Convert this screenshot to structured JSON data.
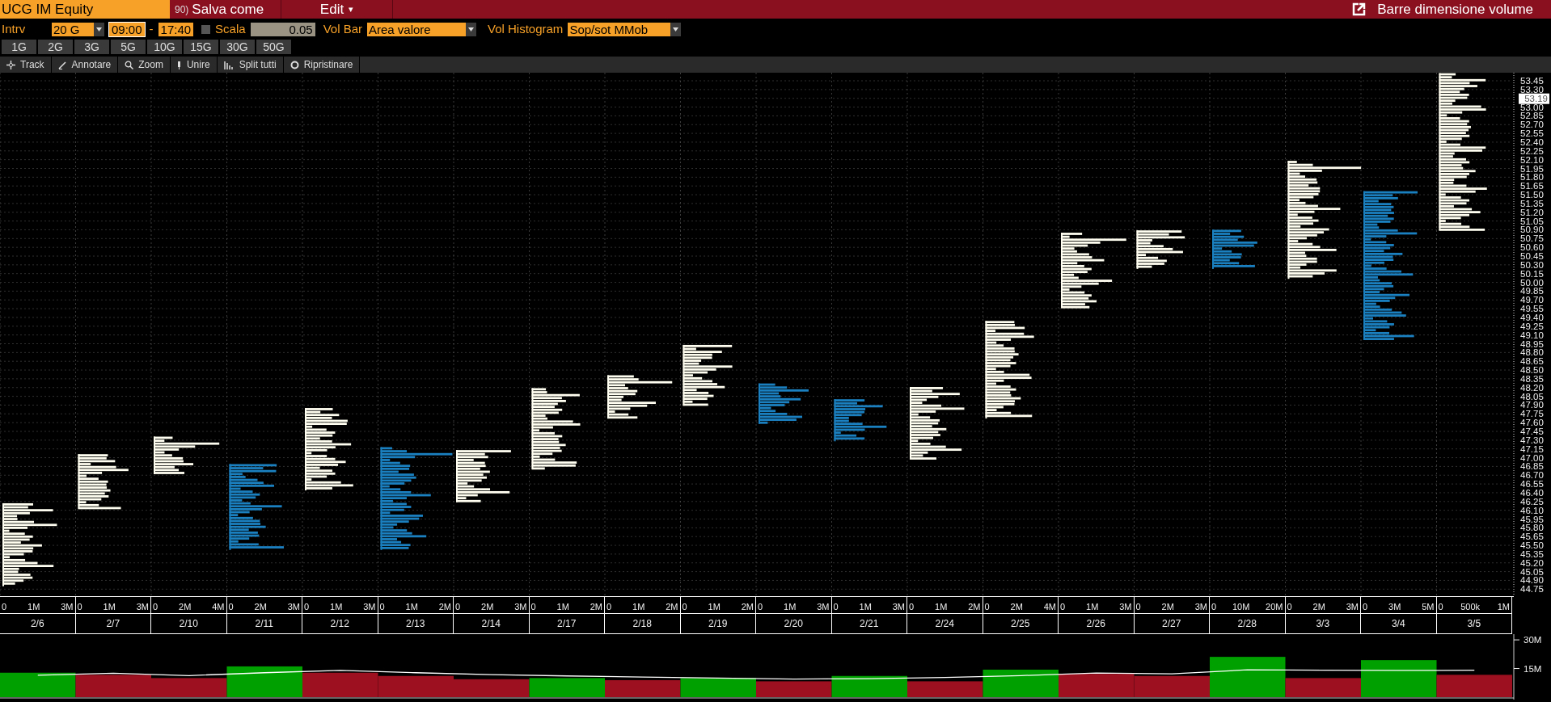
{
  "header": {
    "ticker": "UCG IM Equity",
    "save_tag": "90)",
    "save_label": "Salva come",
    "edit_label": "Edit",
    "edit_caret": "▾",
    "right_label": "Barre dimensione volume"
  },
  "controls": {
    "interval_label": "Intrv",
    "interval_value": "20 G",
    "time_from": "09:00",
    "time_sep": "-",
    "time_to": "17:40",
    "scale_checked": false,
    "scale_label": "Scala",
    "scale_value": "0.05",
    "volbar_label": "Vol Bar",
    "volbar_value": "Area valore",
    "volhist_label": "Vol Histogram",
    "volhist_value": "Sop/sot MMob"
  },
  "periods": [
    {
      "label": "1G",
      "selected": false
    },
    {
      "label": "2G",
      "selected": false
    },
    {
      "label": "3G",
      "selected": false
    },
    {
      "label": "5G",
      "selected": false
    },
    {
      "label": "10G",
      "selected": false
    },
    {
      "label": "15G",
      "selected": false
    },
    {
      "label": "30G",
      "selected": false
    },
    {
      "label": "50G",
      "selected": false
    }
  ],
  "tools": [
    {
      "kind": "track",
      "label": "Track"
    },
    {
      "kind": "annotate",
      "label": "Annotare"
    },
    {
      "kind": "zoom",
      "label": "Zoom"
    },
    {
      "kind": "merge",
      "label": "Unire"
    },
    {
      "kind": "split",
      "label": "Split tutti"
    },
    {
      "kind": "reset",
      "label": "Ripristinare"
    }
  ],
  "price_axis": [
    {
      "kind": "tick",
      "label": "53.45"
    },
    {
      "kind": "tick",
      "label": "53.30"
    },
    {
      "kind": "last",
      "label": "53.19"
    },
    {
      "kind": "tick",
      "label": "53.00"
    },
    {
      "kind": "tick",
      "label": "52.85"
    },
    {
      "kind": "tick",
      "label": "52.70"
    },
    {
      "kind": "tick",
      "label": "52.55"
    },
    {
      "kind": "tick",
      "label": "52.40"
    },
    {
      "kind": "tick",
      "label": "52.25"
    },
    {
      "kind": "tick",
      "label": "52.10"
    },
    {
      "kind": "tick",
      "label": "51.95"
    },
    {
      "kind": "tick",
      "label": "51.80"
    },
    {
      "kind": "tick",
      "label": "51.65"
    },
    {
      "kind": "tick",
      "label": "51.50"
    },
    {
      "kind": "tick",
      "label": "51.35"
    },
    {
      "kind": "tick",
      "label": "51.20"
    },
    {
      "kind": "tick",
      "label": "51.05"
    },
    {
      "kind": "tick",
      "label": "50.90"
    },
    {
      "kind": "tick",
      "label": "50.75"
    },
    {
      "kind": "tick",
      "label": "50.60"
    },
    {
      "kind": "tick",
      "label": "50.45"
    },
    {
      "kind": "tick",
      "label": "50.30"
    },
    {
      "kind": "tick",
      "label": "50.15"
    },
    {
      "kind": "tick",
      "label": "50.00"
    },
    {
      "kind": "tick",
      "label": "49.85"
    },
    {
      "kind": "tick",
      "label": "49.70"
    },
    {
      "kind": "tick",
      "label": "49.55"
    },
    {
      "kind": "tick",
      "label": "49.40"
    },
    {
      "kind": "tick",
      "label": "49.25"
    },
    {
      "kind": "tick",
      "label": "49.10"
    },
    {
      "kind": "tick",
      "label": "48.95"
    },
    {
      "kind": "tick",
      "label": "48.80"
    },
    {
      "kind": "tick",
      "label": "48.65"
    },
    {
      "kind": "tick",
      "label": "48.50"
    },
    {
      "kind": "tick",
      "label": "48.35"
    },
    {
      "kind": "tick",
      "label": "48.20"
    },
    {
      "kind": "tick",
      "label": "48.05"
    },
    {
      "kind": "tick",
      "label": "47.90"
    },
    {
      "kind": "tick",
      "label": "47.75"
    },
    {
      "kind": "tick",
      "label": "47.60"
    },
    {
      "kind": "tick",
      "label": "47.45"
    },
    {
      "kind": "tick",
      "label": "47.30"
    },
    {
      "kind": "tick",
      "label": "47.15"
    },
    {
      "kind": "tick",
      "label": "47.00"
    },
    {
      "kind": "tick",
      "label": "46.85"
    },
    {
      "kind": "tick",
      "label": "46.70"
    },
    {
      "kind": "tick",
      "label": "46.55"
    },
    {
      "kind": "tick",
      "label": "46.40"
    },
    {
      "kind": "tick",
      "label": "46.25"
    },
    {
      "kind": "tick",
      "label": "46.10"
    },
    {
      "kind": "tick",
      "label": "45.95"
    },
    {
      "kind": "tick",
      "label": "45.80"
    },
    {
      "kind": "tick",
      "label": "45.65"
    },
    {
      "kind": "tick",
      "label": "45.50"
    },
    {
      "kind": "tick",
      "label": "45.35"
    },
    {
      "kind": "tick",
      "label": "45.20"
    },
    {
      "kind": "tick",
      "label": "45.05"
    },
    {
      "kind": "tick",
      "label": "44.90"
    },
    {
      "kind": "tick",
      "label": "44.75"
    }
  ],
  "days": [
    {
      "color": "#fffef0",
      "scale": [
        "0",
        "1M",
        "3M"
      ]
    },
    {
      "color": "#fffef0",
      "scale": [
        "0",
        "1M",
        "3M"
      ]
    },
    {
      "color": "#fffef0",
      "scale": [
        "0",
        "2M",
        "4M"
      ]
    },
    {
      "color": "#1b80c0",
      "scale": [
        "0",
        "2M",
        "3M"
      ]
    },
    {
      "color": "#fffef0",
      "scale": [
        "0",
        "1M",
        "3M"
      ]
    },
    {
      "color": "#1b80c0",
      "scale": [
        "0",
        "1M",
        "2M"
      ]
    },
    {
      "color": "#fffef0",
      "scale": [
        "0",
        "2M",
        "3M"
      ]
    },
    {
      "color": "#fffef0",
      "scale": [
        "0",
        "1M",
        "2M"
      ]
    },
    {
      "color": "#fffef0",
      "scale": [
        "0",
        "1M",
        "2M"
      ]
    },
    {
      "color": "#fffef0",
      "scale": [
        "0",
        "1M",
        "2M"
      ]
    },
    {
      "color": "#1b80c0",
      "scale": [
        "0",
        "1M",
        "3M"
      ]
    },
    {
      "color": "#1b80c0",
      "scale": [
        "0",
        "1M",
        "3M"
      ]
    },
    {
      "color": "#fffef0",
      "scale": [
        "0",
        "1M",
        "2M"
      ]
    },
    {
      "color": "#fffef0",
      "scale": [
        "0",
        "2M",
        "4M"
      ]
    },
    {
      "color": "#fffef0",
      "scale": [
        "0",
        "1M",
        "3M"
      ]
    },
    {
      "color": "#fffef0",
      "scale": [
        "0",
        "2M",
        "3M"
      ]
    },
    {
      "color": "#1b80c0",
      "scale": [
        "0",
        "10M",
        "20M"
      ]
    },
    {
      "color": "#fffef0",
      "scale": [
        "0",
        "2M",
        "3M"
      ]
    },
    {
      "color": "#1b80c0",
      "scale": [
        "0",
        "3M",
        "5M"
      ]
    },
    {
      "color": "#fffef0",
      "scale": [
        "0",
        "500k",
        "1M"
      ]
    }
  ],
  "volume_chart": {
    "chart_data": {
      "type": "bar",
      "categories": [
        "2/6",
        "2/7",
        "2/10",
        "2/11",
        "2/12",
        "2/13",
        "2/14",
        "2/17",
        "2/18",
        "2/19",
        "2/20",
        "2/21",
        "2/24",
        "2/25",
        "2/26",
        "2/27",
        "2/28",
        "3/3",
        "3/4",
        "3/5"
      ],
      "series": [
        {
          "type": "bar",
          "color": "#00a000",
          "values": [
            12.8,
            null,
            null,
            16.1,
            null,
            null,
            null,
            10,
            null,
            10,
            null,
            11.1,
            null,
            14.4,
            null,
            null,
            21.1,
            null,
            19.4,
            null
          ]
        },
        {
          "type": "bar",
          "color": "#9c1020",
          "values": [
            null,
            11.7,
            10,
            null,
            12.8,
            11.1,
            9.4,
            null,
            8.9,
            null,
            8.3,
            null,
            8.3,
            null,
            12.2,
            11.1,
            null,
            10,
            null,
            11.7
          ]
        },
        {
          "type": "line",
          "color": "#ffffff",
          "values": [
            11.5,
            12.5,
            11.3,
            12.8,
            14,
            12.8,
            11.8,
            11.1,
            10.5,
            10,
            9.5,
            9.7,
            10.3,
            11.3,
            12.6,
            12.2,
            14.3,
            14.1,
            14,
            14.1
          ]
        }
      ],
      "ylim": [
        0,
        33
      ],
      "yticks": [
        {
          "value": 15,
          "label": "15M"
        },
        {
          "value": 30,
          "label": "30M"
        }
      ]
    }
  }
}
